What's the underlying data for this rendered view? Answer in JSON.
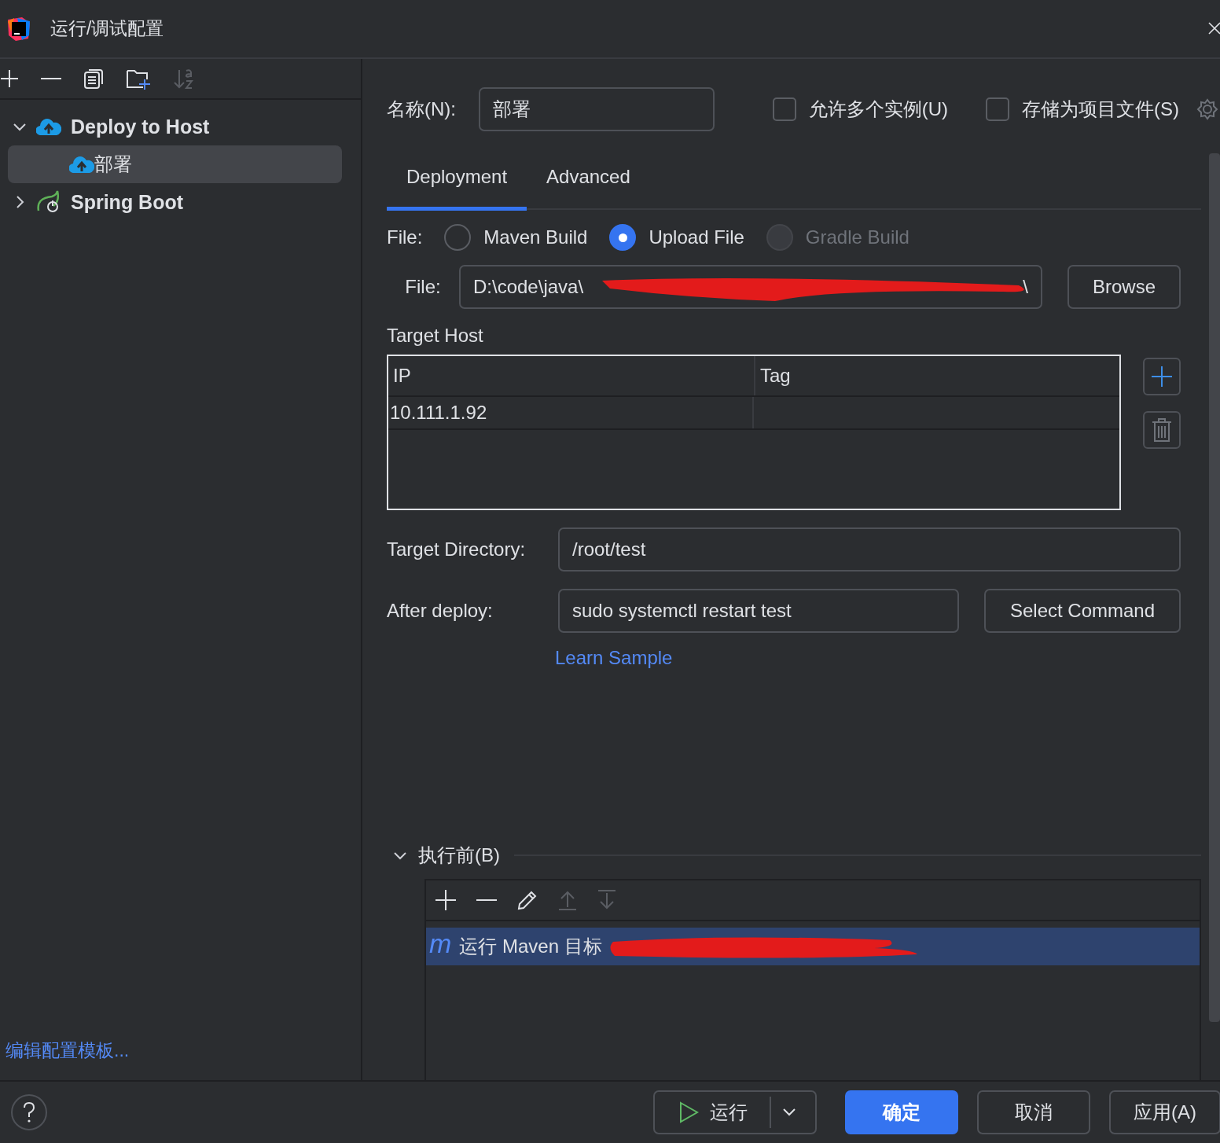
{
  "window": {
    "title": "运行/调试配置"
  },
  "tree": [
    {
      "label": "Deploy to Host",
      "kind": "deploy",
      "expanded": true,
      "selected": false,
      "children": [
        {
          "label": "部署",
          "kind": "deploy",
          "selected": true
        }
      ]
    },
    {
      "label": "Spring Boot",
      "kind": "spring",
      "expanded": false,
      "selected": false
    }
  ],
  "edit_templates_link": "编辑配置模板...",
  "name": {
    "label": "名称(N):",
    "value": "部署"
  },
  "options": [
    {
      "label": "允许多个实例(U)",
      "checked": false
    },
    {
      "label": "存储为项目文件(S)",
      "checked": false
    }
  ],
  "tabs": [
    {
      "label": "Deployment",
      "selected": true
    },
    {
      "label": "Advanced",
      "selected": false
    }
  ],
  "file_source": {
    "label": "File:",
    "options": [
      {
        "label": "Maven Build",
        "selected": false,
        "disabled": false
      },
      {
        "label": "Upload File",
        "selected": true,
        "disabled": false
      },
      {
        "label": "Gradle Build",
        "selected": false,
        "disabled": true
      }
    ]
  },
  "file": {
    "label": "File:",
    "value": "D:\\code\\java\\",
    "value_end": "\\",
    "redacted": true,
    "button": "Browse"
  },
  "target_host": {
    "title": "Target Host",
    "columns": [
      "IP",
      "Tag"
    ],
    "rows": [
      {
        "ip": "10.111.1.92"
      }
    ]
  },
  "target_directory": {
    "label": "Target Directory:",
    "value": "/root/test"
  },
  "after_deploy": {
    "label": "After deploy:",
    "value": "sudo systemctl restart test",
    "button": "Select Command",
    "link": "Learn Sample"
  },
  "before_launch": {
    "title": "执行前(B)",
    "expanded": true,
    "tasks": [
      {
        "glyph": "m",
        "label": "运行 Maven 目标",
        "selected": true,
        "redacted": true
      }
    ]
  },
  "footer": {
    "run": "运行",
    "ok": "确定",
    "cancel": "取消",
    "apply": "应用(A)"
  }
}
